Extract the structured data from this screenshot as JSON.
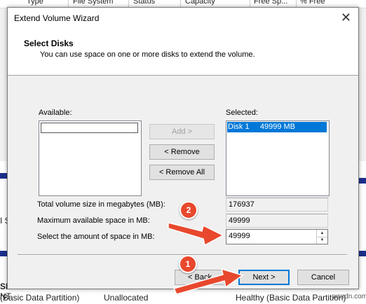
{
  "background_window": {
    "columns": [
      "Type",
      "File System",
      "Status",
      "Capacity",
      "Free Sp...",
      "% Free"
    ],
    "left_fragments": [
      "I S",
      "SD",
      "NT",
      "(Basic Data Partition)"
    ],
    "right_fragments": [
      "Unallocated",
      "Healthy (Basic Data Partition)"
    ]
  },
  "dialog": {
    "title": "Extend Volume Wizard",
    "heading": "Select Disks",
    "subheading": "You can use space on one or more disks to extend the volume.",
    "available_label": "Available:",
    "selected_label": "Selected:",
    "selected_items": [
      {
        "label": "Disk 1     49999 MB"
      }
    ],
    "buttons": {
      "add": "Add >",
      "remove": "< Remove",
      "remove_all": "< Remove All",
      "back": "< Back",
      "next": "Next >",
      "cancel": "Cancel"
    },
    "fields": {
      "total_label": "Total volume size in megabytes (MB):",
      "total_value": "176937",
      "max_label": "Maximum available space in MB:",
      "max_value": "49999",
      "amount_label": "Select the amount of space in MB:",
      "amount_value": "49999"
    }
  },
  "annotations": {
    "badge_1": "1",
    "badge_2": "2",
    "arrow_color": "#e8482d"
  },
  "watermark": "wsxdn.com"
}
